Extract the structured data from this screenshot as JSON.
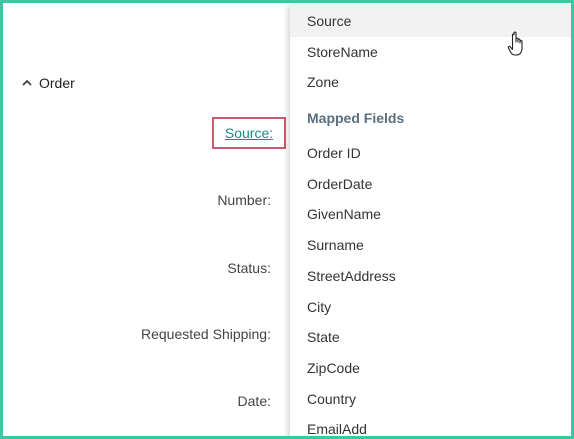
{
  "section": {
    "title": "Order",
    "expanded": true
  },
  "form": {
    "source_label": "Source:",
    "number_label": "Number:",
    "status_label": "Status:",
    "shipping_label": "Requested Shipping:",
    "date_label": "Date:"
  },
  "dropdown": {
    "top_items": [
      "Source",
      "StoreName",
      "Zone"
    ],
    "hovered_item": "Source",
    "header": "Mapped Fields",
    "mapped_items": [
      "Order ID",
      "OrderDate",
      "GivenName",
      "Surname",
      "StreetAddress",
      "City",
      "State",
      "ZipCode",
      "Country",
      "EmailAdd"
    ]
  },
  "colors": {
    "frame_border": "#3cc7a2",
    "link": "#1c8a84",
    "highlight_border": "#cc5a6a",
    "header_text": "#5a6f80"
  }
}
